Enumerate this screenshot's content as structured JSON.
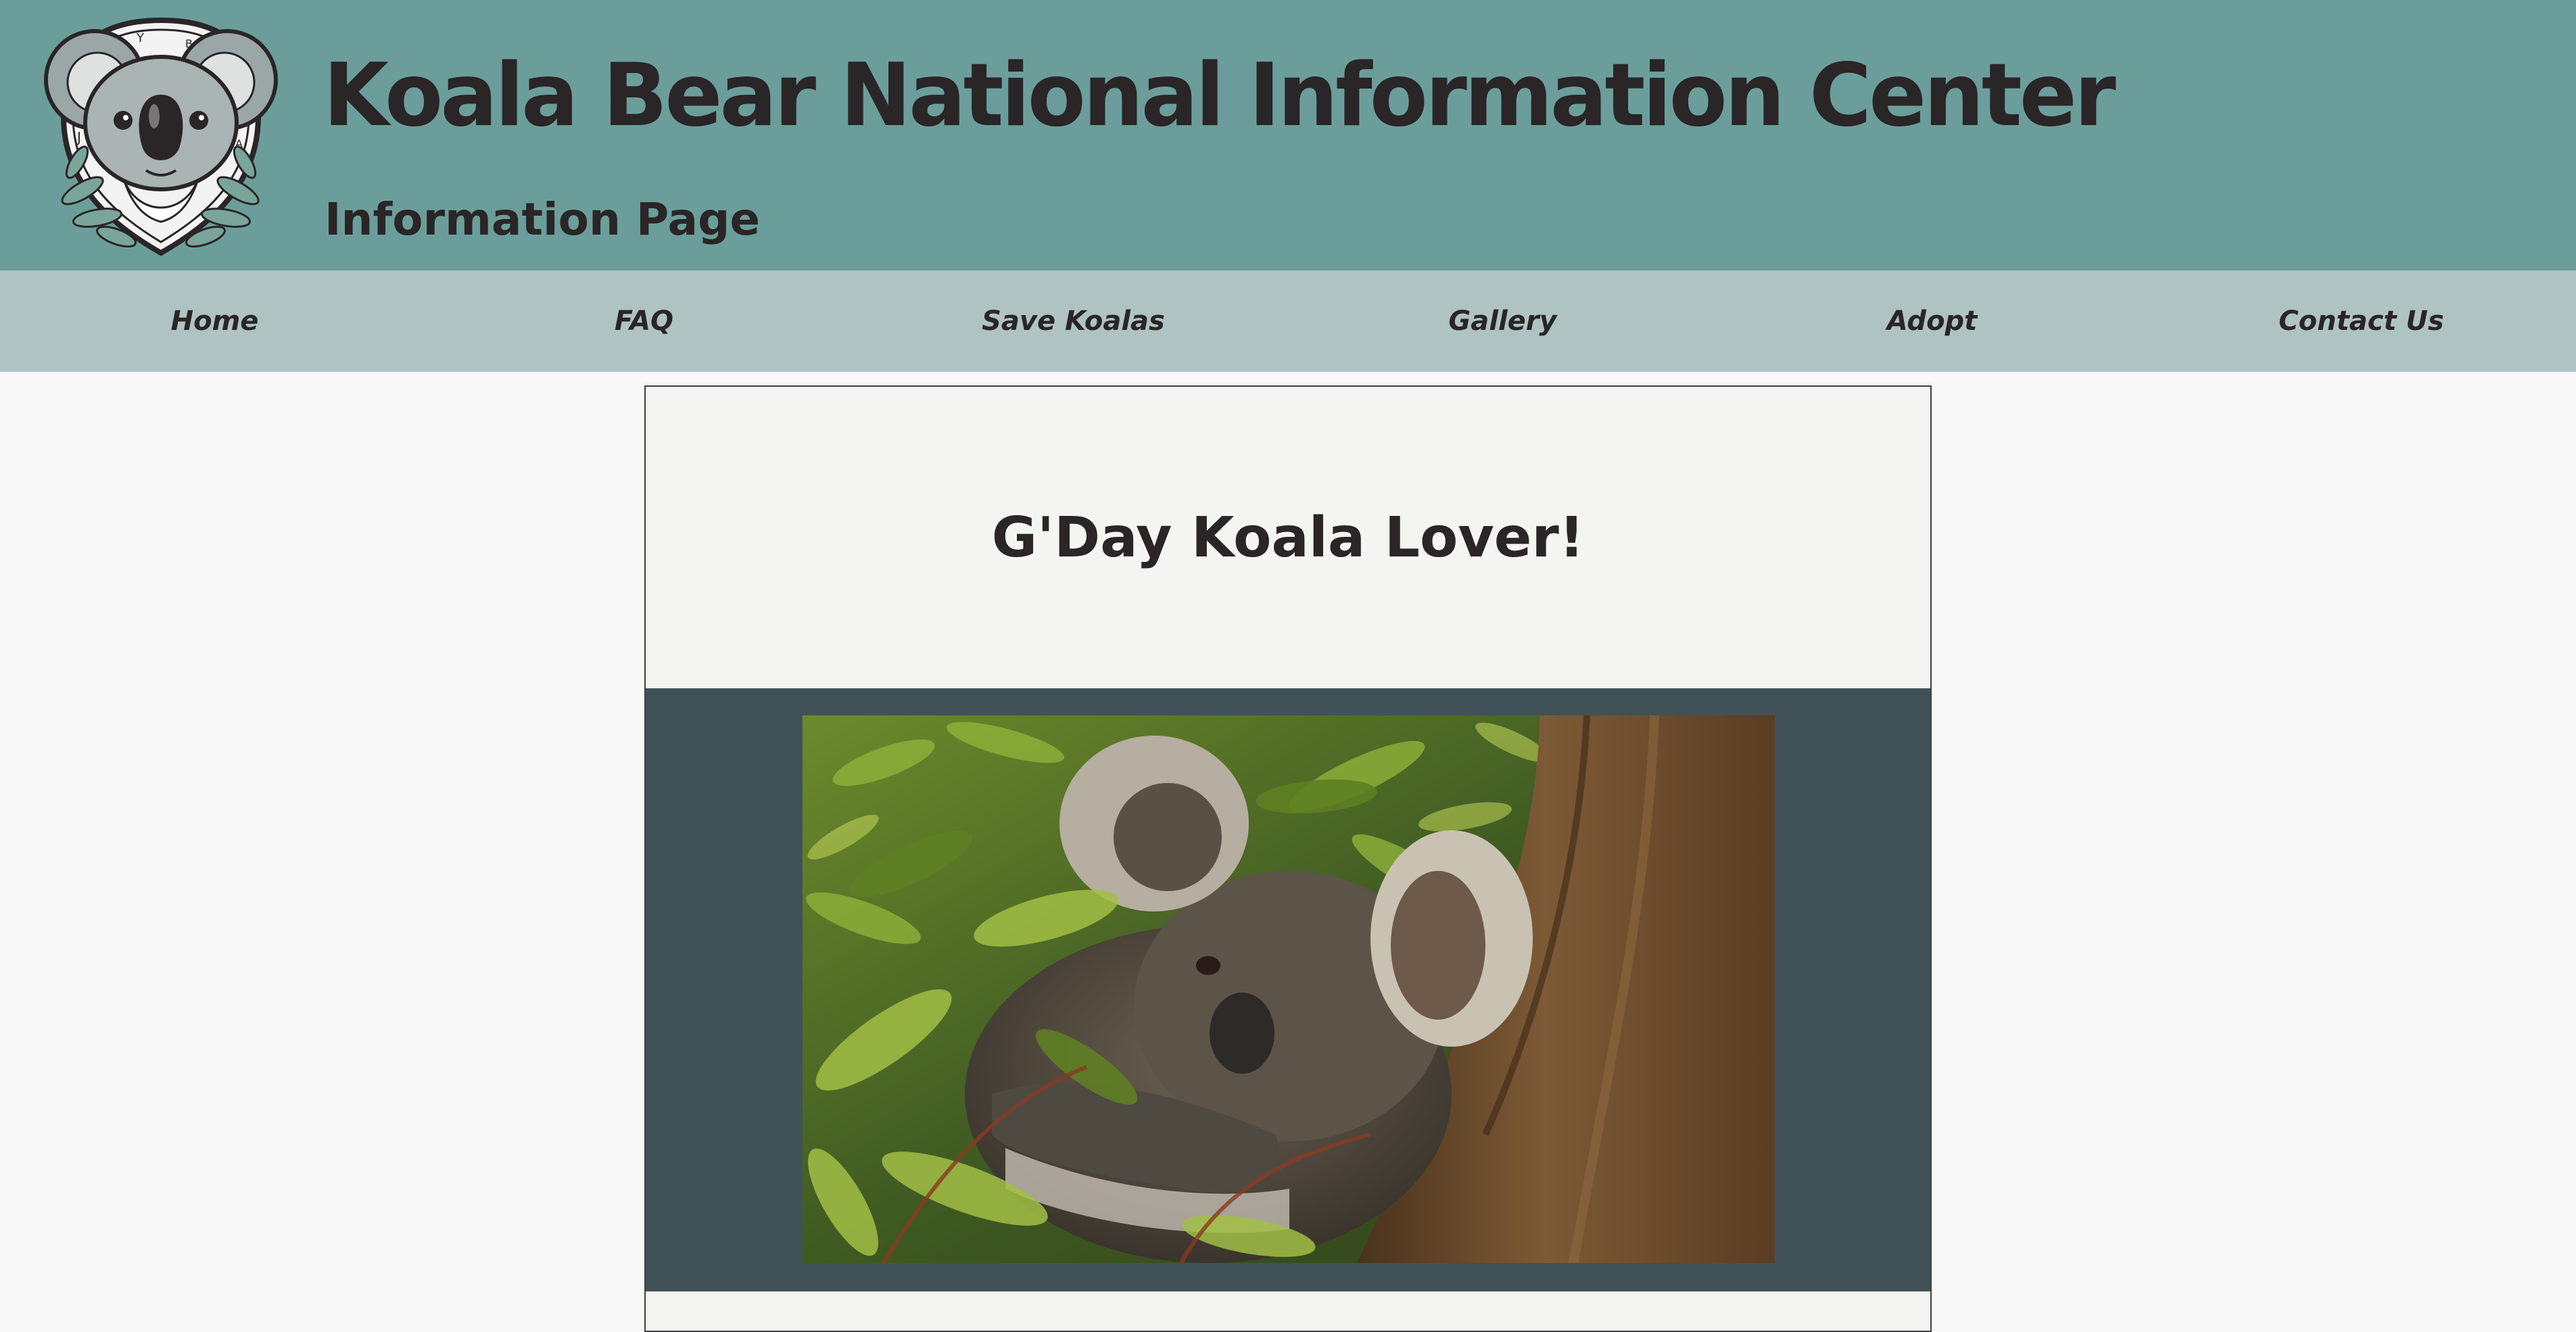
{
  "header": {
    "site_title": "Koala Bear National Information Center",
    "subtitle": "Information Page",
    "logo_letters": [
      "J",
      "Y",
      "B",
      "O",
      "A"
    ]
  },
  "nav": {
    "items": [
      {
        "label": "Home"
      },
      {
        "label": "FAQ"
      },
      {
        "label": "Save Koalas"
      },
      {
        "label": "Gallery"
      },
      {
        "label": "Adopt"
      },
      {
        "label": "Contact Us"
      }
    ]
  },
  "main": {
    "greeting": "G'Day Koala Lover!"
  },
  "colors": {
    "header_bg": "#6b9e9b",
    "nav_bg": "#afc3c3",
    "text": "#2a2526",
    "image_band_bg": "#405257",
    "page_bg": "#f8f8f8"
  },
  "icons": {
    "logo": "koala-face-logo-icon"
  }
}
